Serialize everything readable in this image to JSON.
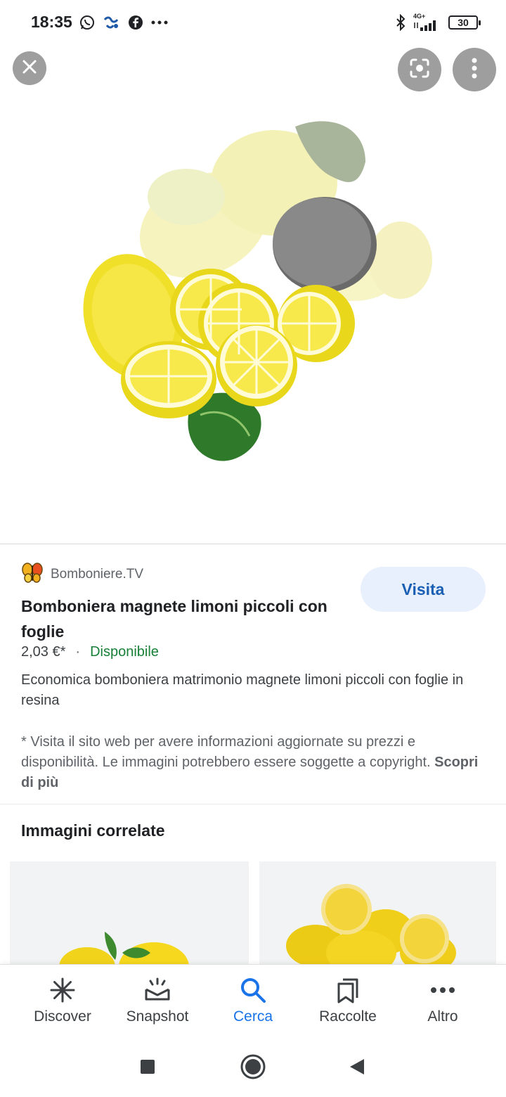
{
  "status_bar": {
    "time": "18:35",
    "left_icons": [
      "whatsapp-icon",
      "app-notification-icon",
      "facebook-icon",
      "more-dots-icon"
    ],
    "network_label": "4G+",
    "battery": "30"
  },
  "top_controls": {
    "close_icon": "close-icon",
    "lens_icon": "lens-icon",
    "menu_icon": "vertical-dots-icon"
  },
  "product": {
    "site_name": "Bomboniere.TV",
    "visit_label": "Visita",
    "title": "Bomboniera magnete limoni piccoli con foglie",
    "price": "2,03 €*",
    "separator": "·",
    "availability": "Disponibile",
    "description": "Economica bomboniera matrimonio magnete limoni piccoli con foglie in resina",
    "disclaimer": "* Visita il sito web per avere informazioni aggiornate su prezzi e disponibilità. Le immagini potrebbero essere soggette a copyright.",
    "learn_more": "Scopri di più"
  },
  "related": {
    "title": "Immagini correlate"
  },
  "bottom_nav": {
    "items": [
      {
        "label": "Discover",
        "icon": "asterisk-icon"
      },
      {
        "label": "Snapshot",
        "icon": "snapshot-icon"
      },
      {
        "label": "Cerca",
        "icon": "search-icon",
        "active": true
      },
      {
        "label": "Raccolte",
        "icon": "collections-icon"
      },
      {
        "label": "Altro",
        "icon": "more-horizontal-icon"
      }
    ]
  },
  "colors": {
    "accent_blue": "#1a73e8",
    "available_green": "#188038",
    "visit_bg": "#e8f0fe"
  }
}
